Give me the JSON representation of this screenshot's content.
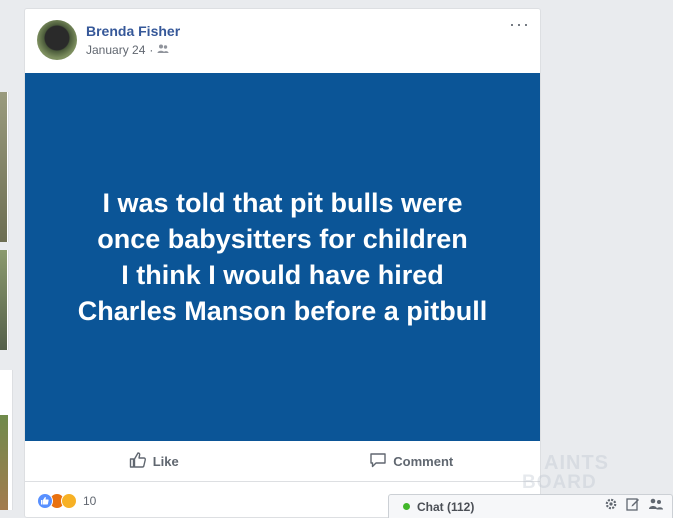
{
  "post": {
    "author": "Brenda Fisher",
    "date": "January 24",
    "date_separator": "·",
    "privacy_icon": "friends-icon",
    "more_label": "···",
    "image_text": "I was told that pit bulls were\nonce babysitters for children\nI think I would have hired\nCharles Manson before a pitbull",
    "image_bg": "#0b5597",
    "actions": {
      "like_label": "Like",
      "comment_label": "Comment"
    },
    "reactions": {
      "types": [
        "like",
        "angry",
        "haha"
      ],
      "count": "10"
    }
  },
  "chat": {
    "label": "Chat (112)",
    "status_color": "#42b72a",
    "icons": [
      "gear-icon",
      "compose-icon",
      "group-icon"
    ]
  },
  "watermark": {
    "line1": "AINTS",
    "line2": "BOARD"
  }
}
